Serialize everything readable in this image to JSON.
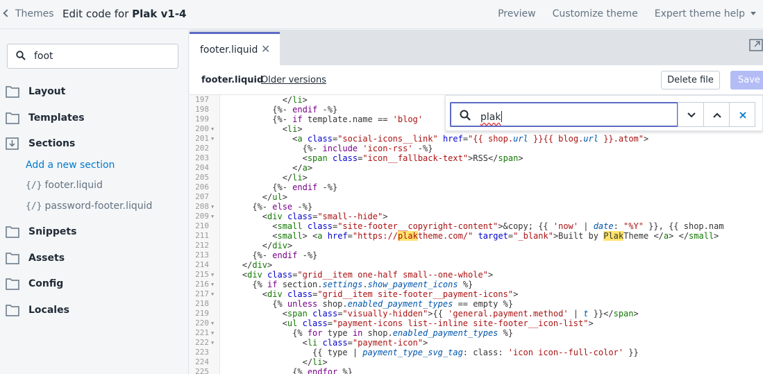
{
  "topbar": {
    "back_label": "Themes",
    "title_prefix": "Edit code for ",
    "title_theme": "Plak v1-4",
    "preview": "Preview",
    "customize": "Customize theme",
    "expert": "Expert theme help"
  },
  "sidebar": {
    "search_value": "foot",
    "folders": {
      "layout": "Layout",
      "templates": "Templates",
      "sections": "Sections",
      "snippets": "Snippets",
      "assets": "Assets",
      "config": "Config",
      "locales": "Locales"
    },
    "add_section": "Add a new section",
    "files": [
      "footer.liquid",
      "password-footer.liquid"
    ],
    "file_bracket": "{/}"
  },
  "tab": {
    "label": "footer.liquid",
    "close": "✕"
  },
  "filebar": {
    "filename": "footer.liquid",
    "older_versions": "Older versions",
    "delete_label": "Delete file",
    "save_label": "Save"
  },
  "find": {
    "value": "plak"
  },
  "colors": {
    "accent": "#5c6ac4",
    "link": "#007ace",
    "highlight": "#ffe36b"
  },
  "code_lines": [
    {
      "n": "197",
      "fold": false
    },
    {
      "n": "198",
      "fold": false
    },
    {
      "n": "199",
      "fold": false
    },
    {
      "n": "200",
      "fold": true
    },
    {
      "n": "201",
      "fold": true
    },
    {
      "n": "202",
      "fold": false
    },
    {
      "n": "203",
      "fold": false
    },
    {
      "n": "204",
      "fold": false
    },
    {
      "n": "205",
      "fold": false
    },
    {
      "n": "206",
      "fold": false
    },
    {
      "n": "207",
      "fold": false
    },
    {
      "n": "208",
      "fold": true
    },
    {
      "n": "209",
      "fold": true
    },
    {
      "n": "210",
      "fold": false
    },
    {
      "n": "211",
      "fold": false
    },
    {
      "n": "212",
      "fold": false
    },
    {
      "n": "213",
      "fold": false
    },
    {
      "n": "214",
      "fold": false
    },
    {
      "n": "215",
      "fold": true
    },
    {
      "n": "216",
      "fold": true
    },
    {
      "n": "217",
      "fold": true
    },
    {
      "n": "218",
      "fold": false
    },
    {
      "n": "219",
      "fold": false
    },
    {
      "n": "220",
      "fold": true
    },
    {
      "n": "221",
      "fold": true
    },
    {
      "n": "222",
      "fold": true
    },
    {
      "n": "223",
      "fold": false
    },
    {
      "n": "224",
      "fold": false
    },
    {
      "n": "225",
      "fold": false
    }
  ]
}
